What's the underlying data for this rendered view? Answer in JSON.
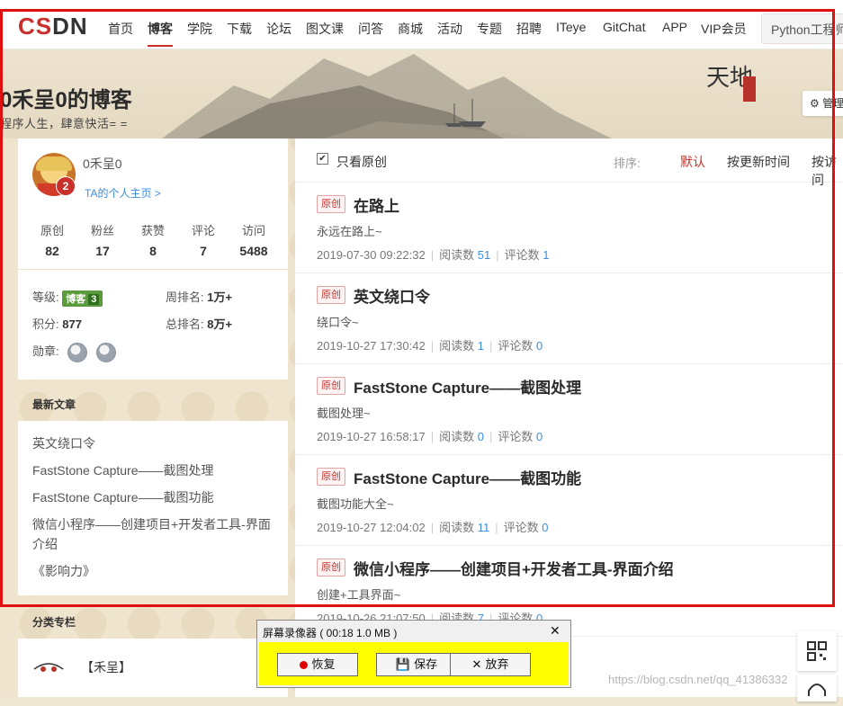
{
  "nav": {
    "logo_red": "CS",
    "logo_dark": "DN",
    "items": [
      "首页",
      "博客",
      "学院",
      "下载",
      "论坛",
      "图文课",
      "问答",
      "商城",
      "活动",
      "专题",
      "招聘",
      "ITeye",
      "GitChat",
      "APP",
      "VIP会员"
    ],
    "active": "博客",
    "search_placeholder": "Python工程师"
  },
  "banner": {
    "title": "0禾呈0的博客",
    "subtitle": "程序人生，肆意快活= =",
    "manage_label": "管理",
    "seal_text": "天地人和"
  },
  "profile": {
    "username": "0禾呈0",
    "level_badge": "2",
    "home_link": "TA的个人主页 >",
    "stats": [
      {
        "label": "原创",
        "value": "82"
      },
      {
        "label": "粉丝",
        "value": "17"
      },
      {
        "label": "获赞",
        "value": "8"
      },
      {
        "label": "评论",
        "value": "7"
      },
      {
        "label": "访问",
        "value": "5488"
      }
    ]
  },
  "grade": {
    "level_label": "等级:",
    "level_badge": "博客",
    "level_num": "3",
    "week_rank_label": "周排名:",
    "week_rank": "1万+",
    "points_label": "积分:",
    "points": "877",
    "total_rank_label": "总排名:",
    "total_rank": "8万+",
    "medals_label": "勋章:"
  },
  "recent": {
    "header": "最新文章",
    "items": [
      "英文绕口令",
      "FastStone Capture——截图处理",
      "FastStone Capture——截图功能",
      "微信小程序——创建项目+开发者工具-界面介绍",
      "《影响力》"
    ]
  },
  "category": {
    "header": "分类专栏",
    "name": "【禾呈】"
  },
  "filter": {
    "only_original": "只看原创",
    "sort_label": "排序:",
    "sort_options": [
      "默认",
      "按更新时间",
      "按访问"
    ]
  },
  "articles": [
    {
      "badge": "原创",
      "title": "在路上",
      "desc": "永远在路上~",
      "date": "2019-07-30 09:22:32",
      "read_label": "阅读数",
      "reads": "51",
      "comment_label": "评论数",
      "comments": "1"
    },
    {
      "badge": "原创",
      "title": "英文绕口令",
      "desc": "绕口令~",
      "date": "2019-10-27 17:30:42",
      "read_label": "阅读数",
      "reads": "1",
      "comment_label": "评论数",
      "comments": "0"
    },
    {
      "badge": "原创",
      "title": "FastStone Capture——截图处理",
      "desc": "截图处理~",
      "date": "2019-10-27 16:58:17",
      "read_label": "阅读数",
      "reads": "0",
      "comment_label": "评论数",
      "comments": "0"
    },
    {
      "badge": "原创",
      "title": "FastStone Capture——截图功能",
      "desc": "截图功能大全~",
      "date": "2019-10-27 12:04:02",
      "read_label": "阅读数",
      "reads": "11",
      "comment_label": "评论数",
      "comments": "0"
    },
    {
      "badge": "原创",
      "title": "微信小程序——创建项目+开发者工具-界面介绍",
      "desc": "创建+工具界面~",
      "date": "2019-10-26 21:07:50",
      "read_label": "阅读数",
      "reads": "7",
      "comment_label": "评论数",
      "comments": "0"
    }
  ],
  "recorder": {
    "title": "屏幕录像器 ( 00:18   1.0 MB )",
    "close": "✕",
    "restore": "恢复",
    "save": "保存",
    "discard": "放弃"
  },
  "watermark": "https://blog.csdn.net/qq_41386332",
  "colors": {
    "accent": "#c9302c",
    "link": "#3b8de0",
    "capture_border": "#e01010",
    "recorder_bg": "#ffff00"
  }
}
